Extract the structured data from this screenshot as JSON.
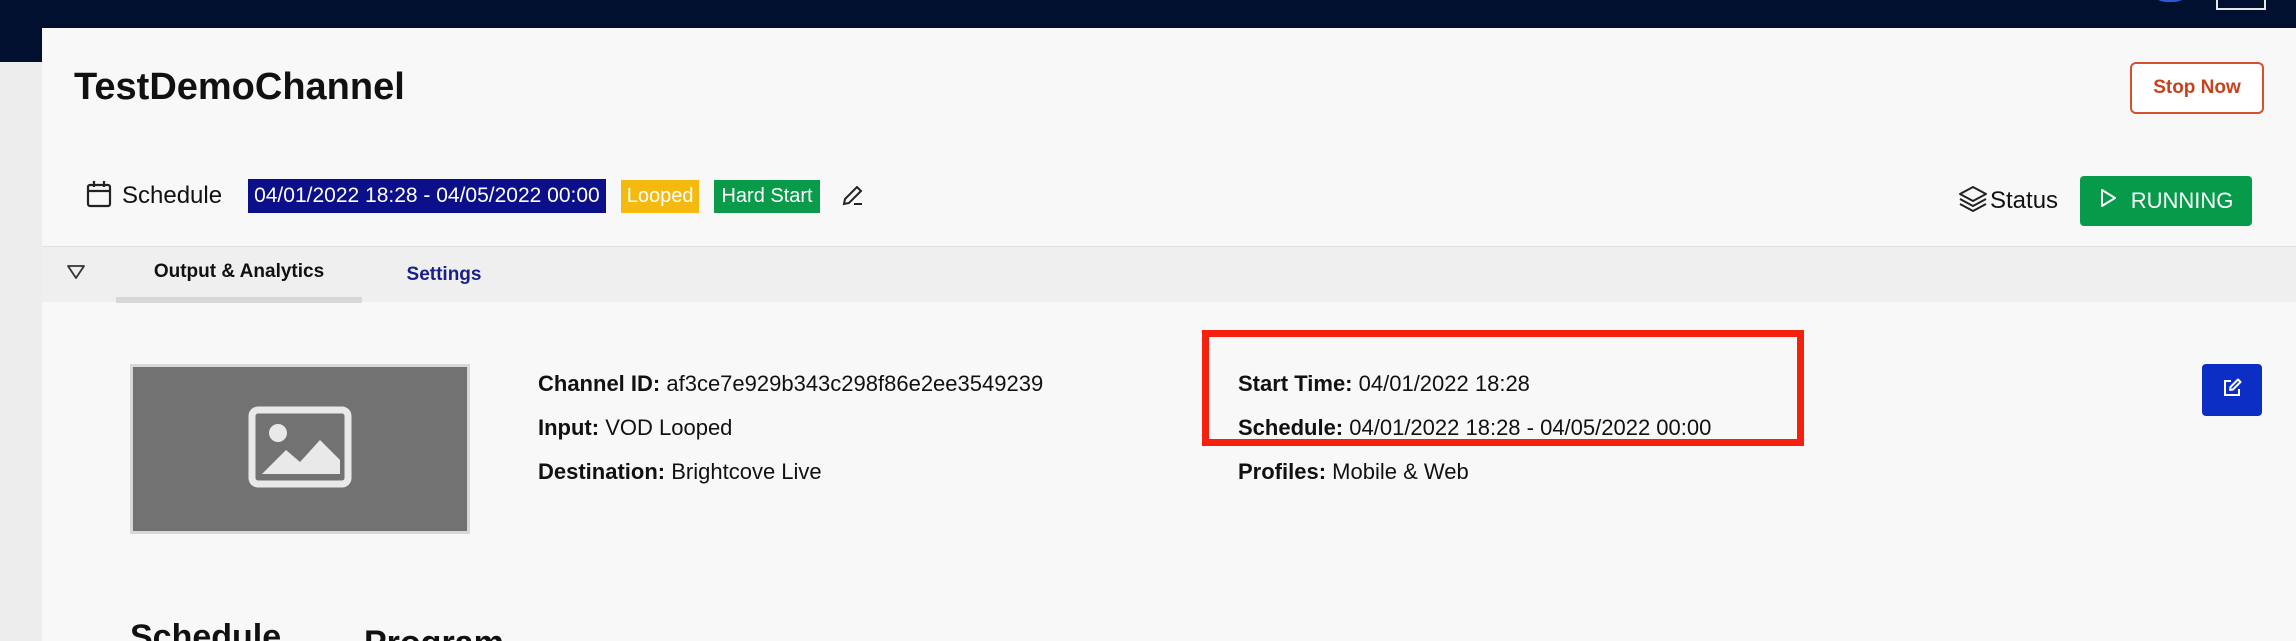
{
  "channel": {
    "title": "TestDemoChannel"
  },
  "header": {
    "stop_label": "Stop Now"
  },
  "schedule_bar": {
    "label": "Schedule",
    "range": "04/01/2022 18:28 - 04/05/2022 00:00",
    "looped_label": "Looped",
    "hard_start_label": "Hard Start"
  },
  "status": {
    "label": "Status",
    "running_label": "RUNNING"
  },
  "tabs": [
    {
      "label": "Output & Analytics",
      "active": true
    },
    {
      "label": "Settings",
      "active": false
    }
  ],
  "details": {
    "channel_id_label": "Channel ID:",
    "channel_id": "af3ce7e929b343c298f86e2ee3549239",
    "input_label": "Input:",
    "input": "VOD Looped",
    "destination_label": "Destination:",
    "destination": "Brightcove Live",
    "start_time_label": "Start Time:",
    "start_time": "04/01/2022 18:28",
    "schedule_label": "Schedule:",
    "schedule": "04/01/2022 18:28 - 04/05/2022 00:00",
    "profiles_label": "Profiles:",
    "profiles": "Mobile & Web"
  },
  "sections": {
    "schedule": "Schedule",
    "program": "Program"
  },
  "colors": {
    "navbar": "#00102e",
    "date_badge": "#0c0f8a",
    "looped_badge": "#f6b90f",
    "hard_start_badge": "#099a4a",
    "running": "#069a4b",
    "stop": "#c8411d",
    "highlight": "#f5210c",
    "edit_button": "#0c2ec4"
  }
}
